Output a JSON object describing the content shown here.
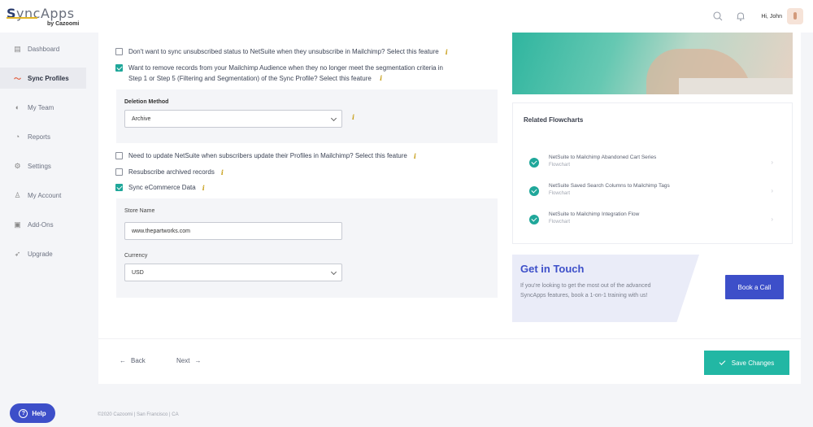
{
  "brand": {
    "name_part1": "S",
    "name_part2": "yncApps",
    "byline": "by Cazoomi"
  },
  "header": {
    "greeting": "Hi, John"
  },
  "sidebar": {
    "items": [
      {
        "label": "Dashboard",
        "icon": "dashboard-icon"
      },
      {
        "label": "Sync Profiles",
        "icon": "sync-icon",
        "active": true
      },
      {
        "label": "My Team",
        "icon": "team-icon"
      },
      {
        "label": "Reports",
        "icon": "reports-icon"
      },
      {
        "label": "Settings",
        "icon": "gear-icon"
      },
      {
        "label": "My Account",
        "icon": "user-icon"
      },
      {
        "label": "Add-Ons",
        "icon": "addons-icon"
      },
      {
        "label": "Upgrade",
        "icon": "rocket-icon"
      }
    ],
    "help_label": "Help"
  },
  "options": {
    "unsubscribe": {
      "label": "Don't want to sync unsubscribed status to NetSuite when they unsubscribe in Mailchimp? Select this feature",
      "checked": false
    },
    "remove_records": {
      "label_line1": "Want to remove records from your Mailchimp Audience when they no longer meet the segmentation criteria in",
      "label_line2": "Step 1 or Step 5 (Filtering and Segmentation) of the Sync Profile? Select this feature",
      "checked": true
    },
    "deletion": {
      "label": "Deletion Method",
      "value": "Archive"
    },
    "update_netsuite": {
      "label": "Need to update NetSuite when subscribers update their Profiles in Mailchimp? Select this feature",
      "checked": false
    },
    "resubscribe": {
      "label": "Resubscribe archived records",
      "checked": false
    },
    "ecommerce": {
      "label": "Sync eCommerce Data",
      "checked": true
    },
    "store": {
      "label": "Store Name",
      "value": "www.thepartworks.com"
    },
    "currency": {
      "label": "Currency",
      "value": "USD"
    }
  },
  "flowcharts": {
    "title": "Related Flowcharts",
    "items": [
      {
        "name": "NetSuite to Mailchimp Abandoned Cart Series",
        "type": "Flowchart"
      },
      {
        "name": "NetSuite Saved Search Columns to Mailchimp Tags",
        "type": "Flowchart"
      },
      {
        "name": "NetSuite to Mailchimp Integration Flow",
        "type": "Flowchart"
      }
    ]
  },
  "touch": {
    "title": "Get in Touch",
    "text": "If you're looking to get the most out of the advanced SyncApps features, book a 1-on-1 training with us!",
    "button": "Book a Call"
  },
  "footer_nav": {
    "back": "Back",
    "next": "Next",
    "save": "Save Changes"
  },
  "footer": {
    "text": "©2020 Cazoomi | San Francisco | CA"
  },
  "colors": {
    "accent": "#1fa79a",
    "primary": "#3d4fc9",
    "info": "#c9a11f"
  }
}
